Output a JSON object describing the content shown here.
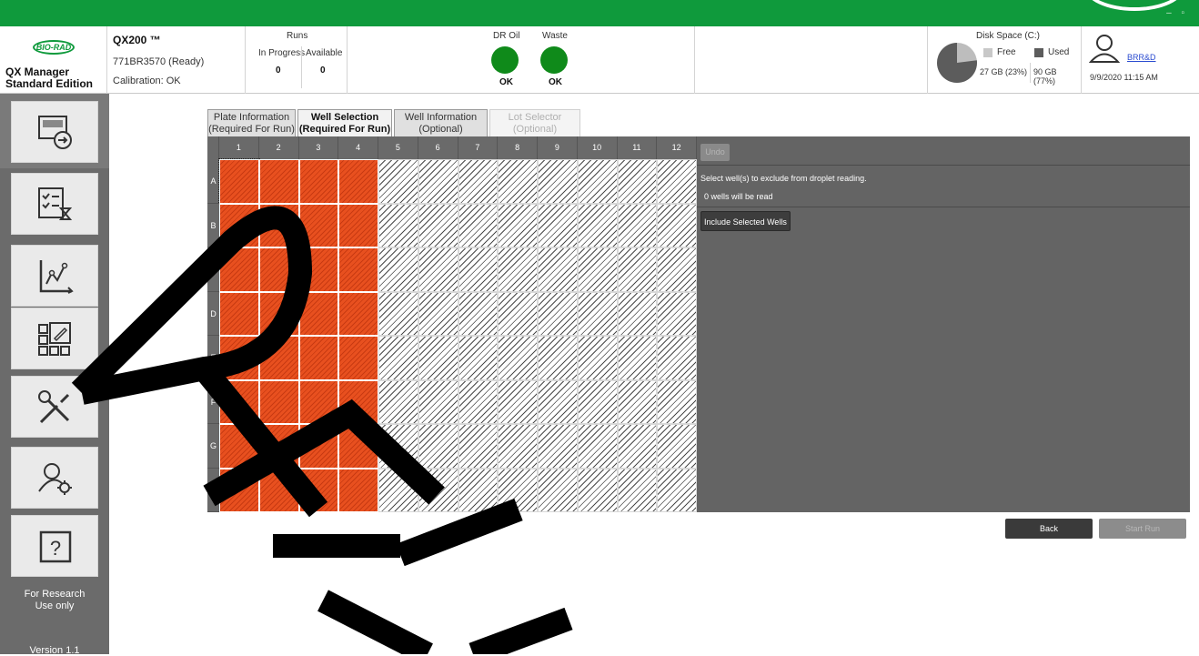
{
  "window": {
    "controls": "– ▫"
  },
  "header": {
    "brand_logo_text": "BIO-RAD",
    "brand_line1": "QX Manager",
    "brand_line2": "Standard Edition",
    "instrument_name": "QX200 ™",
    "instrument_status": "771BR3570 (Ready)",
    "calibration": "Calibration: OK",
    "runs_title": "Runs",
    "runs_in_progress_label": "In Progress",
    "runs_available_label": "Available",
    "runs_in_progress_value": "0",
    "runs_available_value": "0",
    "dr_oil_label": "DR Oil",
    "dr_oil_status": "OK",
    "waste_label": "Waste",
    "waste_status": "OK",
    "disk_title": "Disk Space (C:)",
    "disk_free_label": "Free",
    "disk_used_label": "Used",
    "disk_free_value": "27 GB (23%)",
    "disk_used_value": "90 GB (77%)",
    "disk_used_fraction": 0.77,
    "user_name": "BRR&D",
    "datetime": "9/9/2020 11:15 AM",
    "status_color": "#0f8a1a"
  },
  "sidebar": {
    "research_line1": "For Research",
    "research_line2": "Use only",
    "version": "Version 1.1"
  },
  "tabs": [
    {
      "line1": "Plate Information",
      "line2": "(Required For Run)"
    },
    {
      "line1": "Well Selection",
      "line2": "(Required For Run)"
    },
    {
      "line1": "Well Information",
      "line2": "(Optional)"
    },
    {
      "line1": "Lot Selector",
      "line2": "(Optional)"
    }
  ],
  "plate": {
    "columns": [
      "1",
      "2",
      "3",
      "4",
      "5",
      "6",
      "7",
      "8",
      "9",
      "10",
      "11",
      "12"
    ],
    "rows": [
      "A",
      "B",
      "C",
      "D",
      "E",
      "F",
      "G",
      "H"
    ],
    "selected_columns": [
      "1",
      "2",
      "3",
      "4"
    ],
    "selected_color": "#e8501f"
  },
  "panel": {
    "undo_label": "Undo",
    "instruction": "Select well(s) to exclude from droplet reading.",
    "count_text": "0 wells will be read",
    "include_label": "Include Selected Wells"
  },
  "footer": {
    "back_label": "Back",
    "start_label": "Start Run"
  }
}
